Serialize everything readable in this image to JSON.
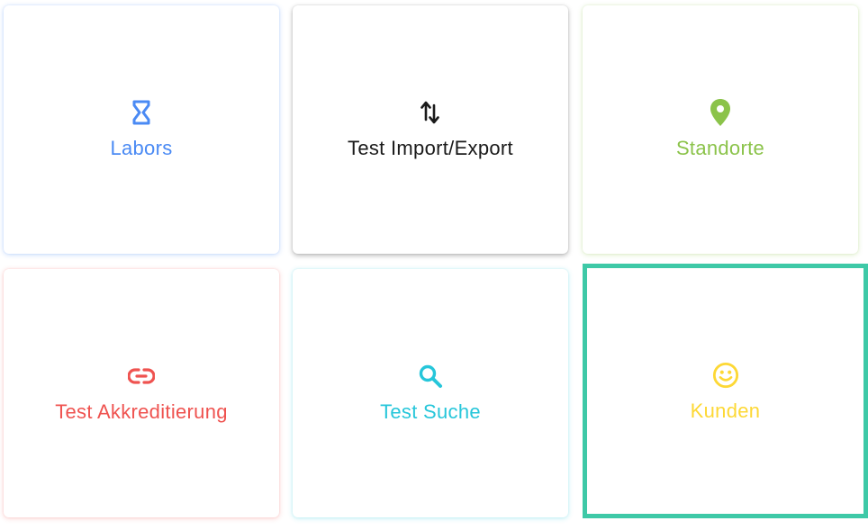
{
  "tiles": [
    {
      "label": "Labors",
      "icon": "hourglass-icon",
      "color": "#4a8af4"
    },
    {
      "label": "Test Import/Export",
      "icon": "swap-vertical-icon",
      "color": "#1a1a1a"
    },
    {
      "label": "Standorte",
      "icon": "map-pin-icon",
      "color": "#8bc34a"
    },
    {
      "label": "Test Akkreditierung",
      "icon": "link-icon",
      "color": "#ef5350"
    },
    {
      "label": "Test Suche",
      "icon": "search-icon",
      "color": "#26c6da"
    },
    {
      "label": "Kunden",
      "icon": "smiley-icon",
      "color": "#fdd835",
      "selected": true,
      "selection_color": "#3ec9a7"
    }
  ]
}
